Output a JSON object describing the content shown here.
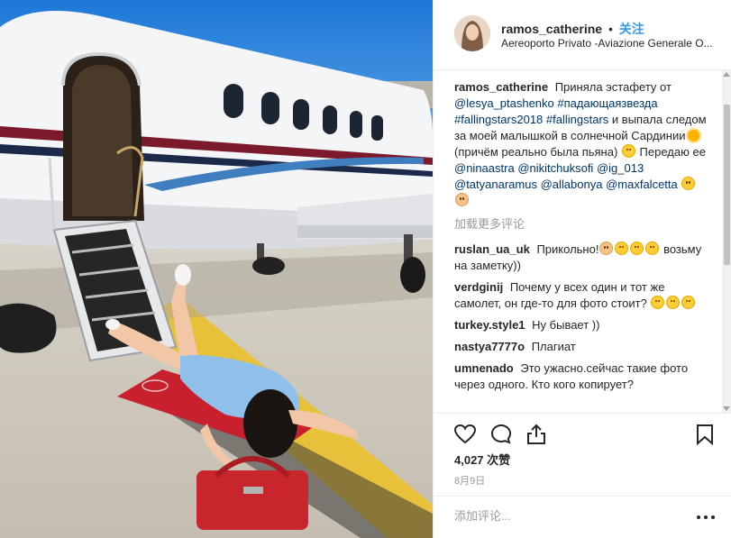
{
  "photo": {
    "alt_subject": "photo"
  },
  "header": {
    "username": "ramos_catherine",
    "separator": "•",
    "follow_label": "关注",
    "location": "Aereoporto Privato -Aviazione Generale O..."
  },
  "caption": {
    "user": "ramos_catherine",
    "text_1": "Приняла эстафету от",
    "tag_1": "@lesya_ptashenko",
    "tag_2": "#падающаязвезда",
    "tag_3": "#fallingstars2018",
    "tag_4": "#fallingstars",
    "text_2": "и выпала следом за моей малышкой в солнечной Сардинии",
    "text_3": "(причём реально была пьяна)",
    "text_4": "Передаю ее",
    "tag_5": "@ninaastra",
    "tag_6": "@nikitchuksofi",
    "tag_7": "@ig_013",
    "tag_8": "@tatyanaramus",
    "tag_9": "@allabonya",
    "tag_10": "@maxfalcetta"
  },
  "load_more": "加载更多评论",
  "comments": [
    {
      "user": "ruslan_ua_uk",
      "text_a": "Прикольно!",
      "text_b": "возьму на заметку))"
    },
    {
      "user": "verdginij",
      "text_a": "Почему у всех один и тот же самолет, он где-то для фото стоит?",
      "text_b": ""
    },
    {
      "user": "turkey.style1",
      "text_a": "Ну бывает ))",
      "text_b": ""
    },
    {
      "user": "nastya7777o",
      "text_a": "Плагиат",
      "text_b": ""
    },
    {
      "user": "umnenado",
      "text_a": "Это ужасно.сейчас такие фото через одного. Кто кого копирует?",
      "text_b": ""
    }
  ],
  "actions": {
    "like_icon": "heart-icon",
    "comment_icon": "comment-icon",
    "share_icon": "share-icon",
    "save_icon": "bookmark-icon"
  },
  "likes": "4,027 次赞",
  "date": "8月9日",
  "add_comment": {
    "placeholder": "添加评论...",
    "more_icon": "ellipsis-icon"
  },
  "colors": {
    "link": "#003569",
    "follow": "#3897f0",
    "muted": "#999999",
    "text": "#262626"
  }
}
